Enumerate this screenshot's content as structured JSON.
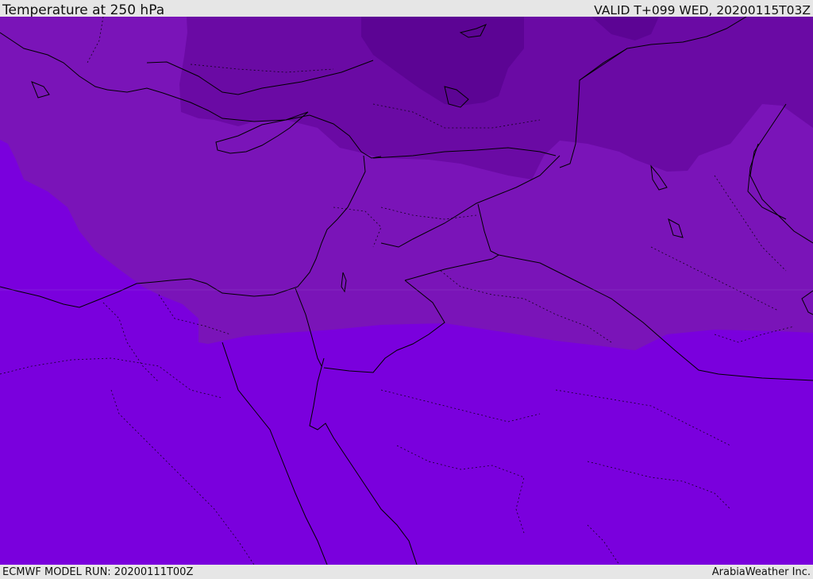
{
  "header": {
    "title": "Temperature at 250 hPa",
    "valid": "VALID T+099 WED, 20200115T03Z"
  },
  "footer": {
    "model_run": "ECMWF MODEL RUN: 20200111T00Z",
    "credit": "ArabiaWeather Inc."
  },
  "map": {
    "variable": "Temperature",
    "level": "250 hPa",
    "colors": {
      "warmest": "#7a00dd",
      "band_2": "#7a14b8",
      "band_3": "#6a0aa4",
      "coldest": "#5c0494",
      "coast_border": "#000000"
    }
  }
}
